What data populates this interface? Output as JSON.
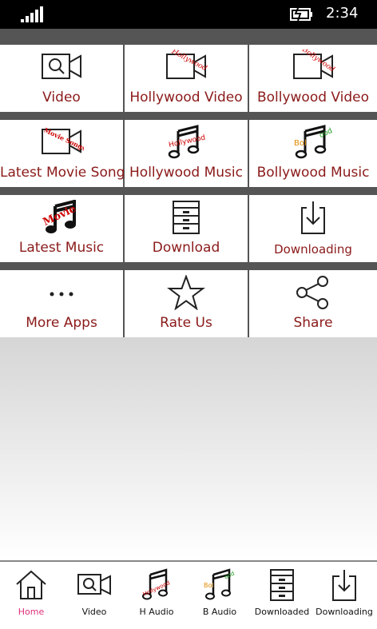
{
  "status": {
    "time": "2:34"
  },
  "tiles": [
    [
      {
        "label": "Video",
        "icon": "video-camera-icon"
      },
      {
        "label": "Hollywood Video",
        "icon": "video-camera-icon",
        "stamp": "Hollywood"
      },
      {
        "label": "Bollywood Video",
        "icon": "video-camera-icon",
        "stamp": "Bollywood"
      }
    ],
    [
      {
        "label": "Latest Movie Song",
        "icon": "video-camera-icon",
        "stamp": "Movie Songs"
      },
      {
        "label": "Hollywood Music",
        "icon": "music-note-icon",
        "stamp": "Hollywood"
      },
      {
        "label": "Bollywood Music",
        "icon": "music-note-icon",
        "stamp_a": "Bol",
        "stamp_b": "ood"
      }
    ],
    [
      {
        "label": "Latest Music",
        "icon": "music-note-icon",
        "stamp": "Movie"
      },
      {
        "label": "Download",
        "icon": "cabinet-icon"
      },
      {
        "label": "Downloading",
        "icon": "download-tray-icon"
      }
    ],
    [
      {
        "label": "More Apps",
        "icon": "more-dots-icon"
      },
      {
        "label": "Rate Us",
        "icon": "star-icon"
      },
      {
        "label": "Share",
        "icon": "share-icon"
      }
    ]
  ],
  "tabs": [
    {
      "label": "Home",
      "icon": "home-icon",
      "active": true
    },
    {
      "label": "Video",
      "icon": "video-camera-icon"
    },
    {
      "label": "H Audio",
      "icon": "music-note-icon",
      "stamp": "Hollywood"
    },
    {
      "label": "B Audio",
      "icon": "music-note-icon",
      "stamp_a": "Bol",
      "stamp_b": "ood"
    },
    {
      "label": "Downloaded",
      "icon": "cabinet-icon"
    },
    {
      "label": "Downloading",
      "icon": "download-tray-icon"
    }
  ],
  "colors": {
    "label": "#8b1a1a",
    "active_tab": "#e0307a",
    "band": "#555555"
  }
}
